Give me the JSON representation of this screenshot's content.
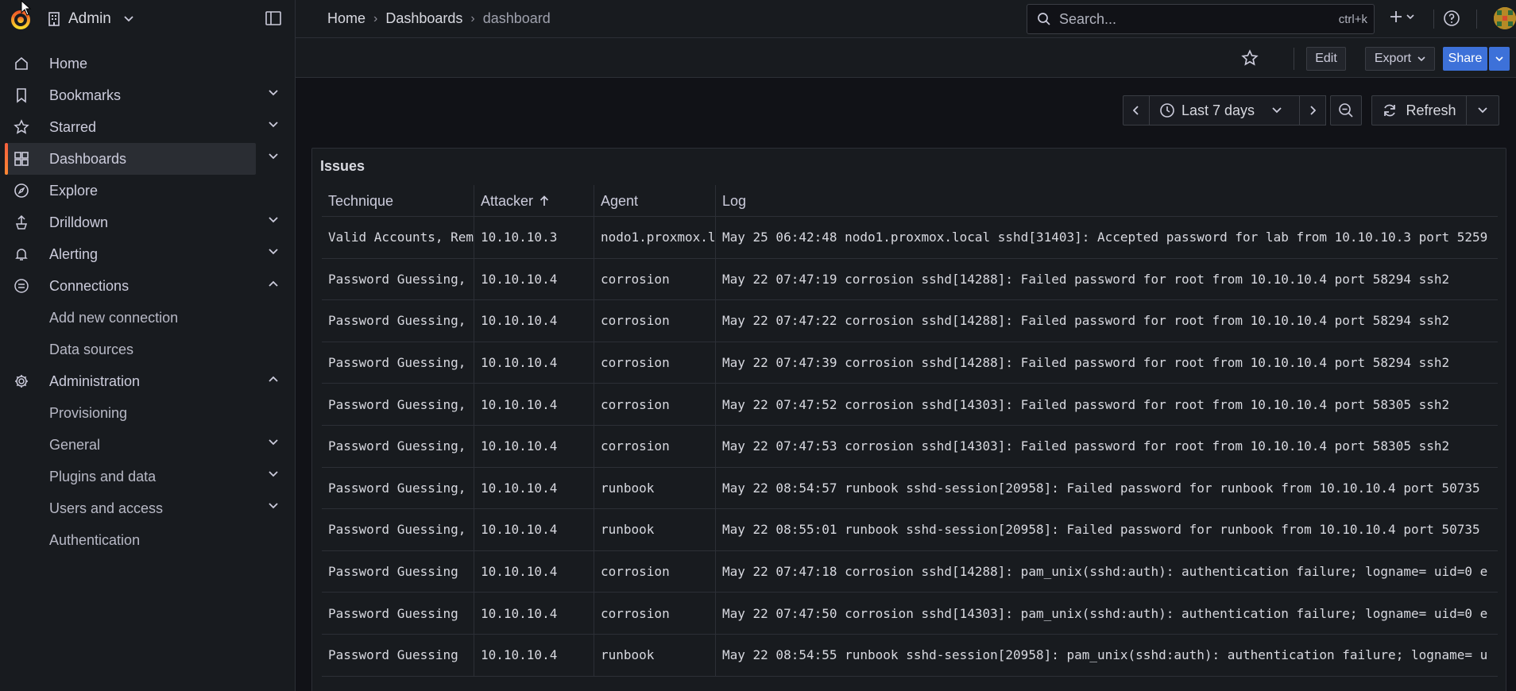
{
  "app": {
    "org_name": "Admin",
    "icons": {
      "logo": "grafana-logo-icon",
      "org": "building-icon",
      "dock": "dock-sidebar-icon"
    }
  },
  "sidebar": {
    "items": [
      {
        "label": "Home",
        "icon": "home-icon",
        "expandable": false
      },
      {
        "label": "Bookmarks",
        "icon": "bookmark-icon",
        "expandable": true,
        "expanded": false
      },
      {
        "label": "Starred",
        "icon": "star-icon",
        "expandable": true,
        "expanded": false
      },
      {
        "label": "Dashboards",
        "icon": "dashboards-grid-icon",
        "expandable": true,
        "expanded": false,
        "active": true
      },
      {
        "label": "Explore",
        "icon": "compass-icon",
        "expandable": false
      },
      {
        "label": "Drilldown",
        "icon": "drilldown-icon",
        "expandable": true,
        "expanded": false
      },
      {
        "label": "Alerting",
        "icon": "bell-icon",
        "expandable": true,
        "expanded": false
      },
      {
        "label": "Connections",
        "icon": "connections-icon",
        "expandable": true,
        "expanded": true
      },
      {
        "label": "Add new connection",
        "sub": true
      },
      {
        "label": "Data sources",
        "sub": true
      },
      {
        "label": "Administration",
        "icon": "gear-icon",
        "expandable": true,
        "expanded": true
      },
      {
        "label": "Provisioning",
        "sub": true
      },
      {
        "label": "General",
        "sub": true,
        "expandable": true
      },
      {
        "label": "Plugins and data",
        "sub": true,
        "expandable": true
      },
      {
        "label": "Users and access",
        "sub": true,
        "expandable": true
      },
      {
        "label": "Authentication",
        "sub": true
      }
    ]
  },
  "topbar": {
    "breadcrumbs": [
      "Home",
      "Dashboards",
      "dashboard"
    ],
    "search_placeholder": "Search...",
    "search_shortcut": "ctrl+k"
  },
  "toolbar": {
    "edit_label": "Edit",
    "export_label": "Export",
    "share_label": "Share",
    "accent_color": "#3d71d9"
  },
  "time_controls": {
    "range_label": "Last 7 days",
    "refresh_label": "Refresh"
  },
  "panel": {
    "title": "Issues",
    "columns": [
      "Technique",
      "Attacker",
      "Agent",
      "Log"
    ],
    "sorted_column": "Attacker",
    "sort_direction": "ascending",
    "rows": [
      [
        "Valid Accounts, Rem",
        "10.10.10.3",
        "nodo1.proxmox.l",
        "May 25 06:42:48 nodo1.proxmox.local sshd[31403]: Accepted password for lab from 10.10.10.3 port 5259"
      ],
      [
        "Password Guessing,",
        "10.10.10.4",
        "corrosion",
        "May 22 07:47:19 corrosion sshd[14288]: Failed password for root from 10.10.10.4 port 58294 ssh2"
      ],
      [
        "Password Guessing,",
        "10.10.10.4",
        "corrosion",
        "May 22 07:47:22 corrosion sshd[14288]: Failed password for root from 10.10.10.4 port 58294 ssh2"
      ],
      [
        "Password Guessing,",
        "10.10.10.4",
        "corrosion",
        "May 22 07:47:39 corrosion sshd[14288]: Failed password for root from 10.10.10.4 port 58294 ssh2"
      ],
      [
        "Password Guessing,",
        "10.10.10.4",
        "corrosion",
        "May 22 07:47:52 corrosion sshd[14303]: Failed password for root from 10.10.10.4 port 58305 ssh2"
      ],
      [
        "Password Guessing,",
        "10.10.10.4",
        "corrosion",
        "May 22 07:47:53 corrosion sshd[14303]: Failed password for root from 10.10.10.4 port 58305 ssh2"
      ],
      [
        "Password Guessing,",
        "10.10.10.4",
        "runbook",
        "May 22 08:54:57 runbook sshd-session[20958]: Failed password for runbook from 10.10.10.4 port 50735"
      ],
      [
        "Password Guessing,",
        "10.10.10.4",
        "runbook",
        "May 22 08:55:01 runbook sshd-session[20958]: Failed password for runbook from 10.10.10.4 port 50735"
      ],
      [
        "Password Guessing",
        "10.10.10.4",
        "corrosion",
        "May 22 07:47:18 corrosion sshd[14288]: pam_unix(sshd:auth): authentication failure; logname= uid=0 e"
      ],
      [
        "Password Guessing",
        "10.10.10.4",
        "corrosion",
        "May 22 07:47:50 corrosion sshd[14303]: pam_unix(sshd:auth): authentication failure; logname= uid=0 e"
      ],
      [
        "Password Guessing",
        "10.10.10.4",
        "runbook",
        "May 22 08:54:55 runbook sshd-session[20958]: pam_unix(sshd:auth): authentication failure; logname= u"
      ]
    ]
  }
}
